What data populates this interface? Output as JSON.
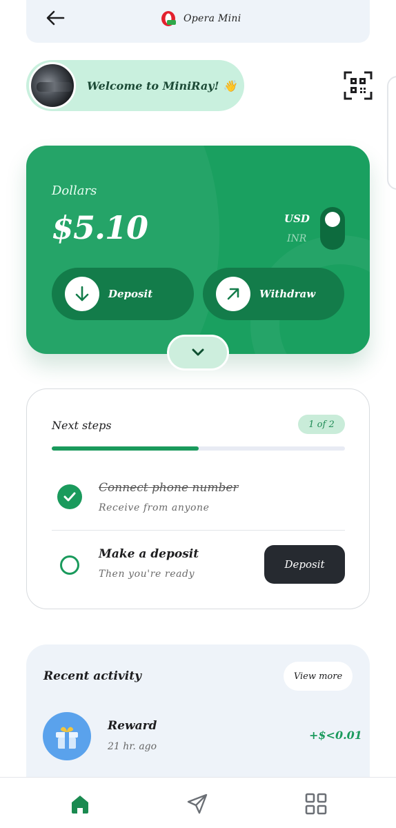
{
  "browser": {
    "app_name": "Opera Mini"
  },
  "welcome": {
    "text": "Welcome to MiniRay! 👋"
  },
  "balance_card": {
    "currency_label": "Dollars",
    "balance": "$5.10",
    "currency_options": [
      "USD",
      "INR"
    ],
    "selected_currency": "USD",
    "deposit_label": "Deposit",
    "withdraw_label": "Withdraw"
  },
  "next_steps": {
    "title": "Next steps",
    "progress_badge": "1 of 2",
    "progress_fraction": 0.5,
    "steps": [
      {
        "title": "Connect phone number",
        "subtitle": "Receive from anyone",
        "completed": true
      },
      {
        "title": "Make a deposit",
        "subtitle": "Then you're ready",
        "completed": false,
        "action_label": "Deposit"
      }
    ]
  },
  "recent_activity": {
    "title": "Recent activity",
    "view_more_label": "View more",
    "items": [
      {
        "title": "Reward",
        "time": "21 hr. ago",
        "amount": "+$<0.01",
        "icon": "gift-icon"
      }
    ]
  },
  "bottom_nav": {
    "items": [
      {
        "icon": "home-icon",
        "active": true
      },
      {
        "icon": "send-icon",
        "active": false
      },
      {
        "icon": "apps-grid-icon",
        "active": false
      }
    ]
  },
  "colors": {
    "brand_green": "#1aa060",
    "accent_dark": "#262a30",
    "welcome_bg": "#c9f0de",
    "panel_bg": "#eef3f9"
  }
}
